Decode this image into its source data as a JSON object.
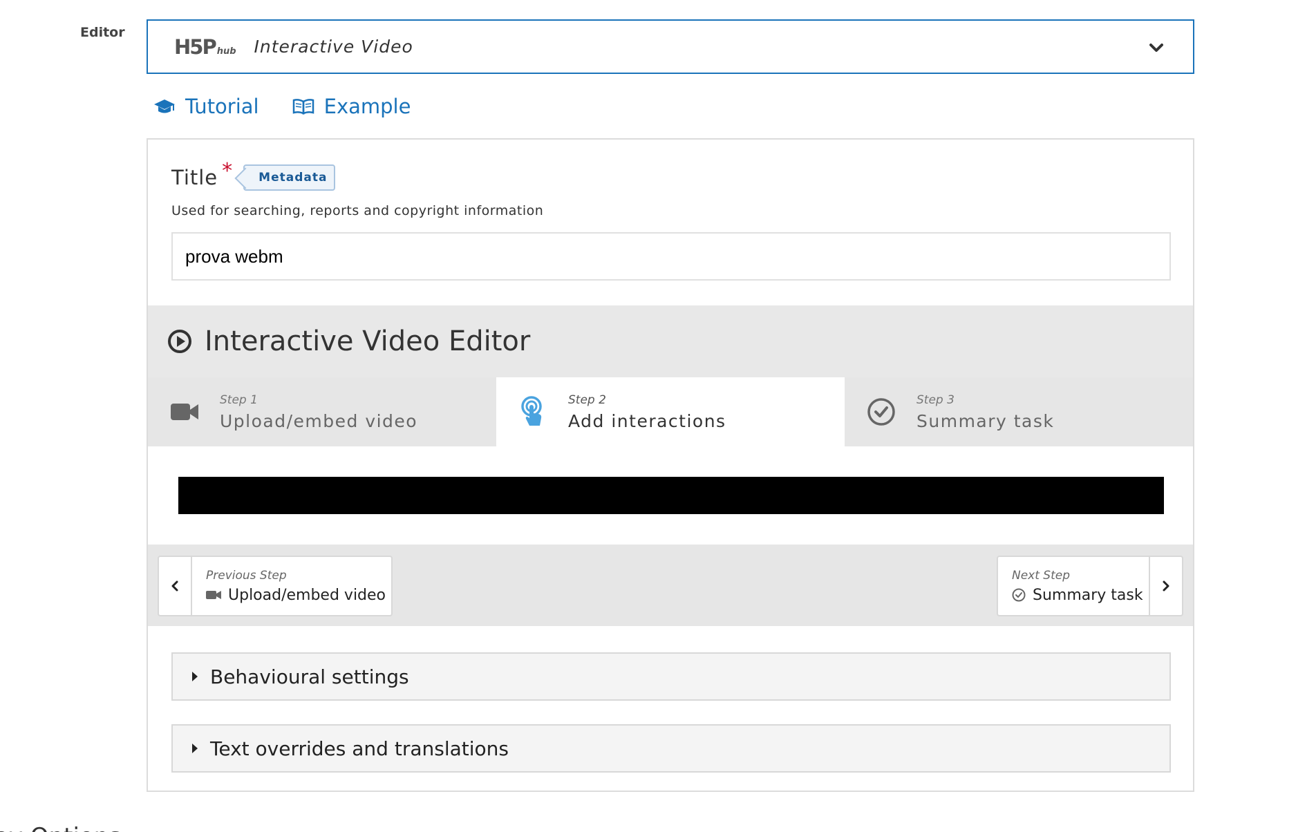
{
  "editor_label": "Editor",
  "hub": {
    "logo_main": "H5P",
    "logo_small": "hub",
    "content_type": "Interactive Video"
  },
  "links": {
    "tutorial": "Tutorial",
    "example": "Example"
  },
  "title_field": {
    "label": "Title",
    "required_mark": "*",
    "metadata_button": "Metadata",
    "description": "Used for searching, reports and copyright information",
    "value": "prova webm"
  },
  "ive": {
    "title": "Interactive Video Editor",
    "steps": [
      {
        "number": "Step 1",
        "name": "Upload/embed video"
      },
      {
        "number": "Step 2",
        "name": "Add interactions"
      },
      {
        "number": "Step 3",
        "name": "Summary task"
      }
    ]
  },
  "navigation": {
    "previous_label": "Previous Step",
    "previous_target": "Upload/embed video",
    "next_label": "Next Step",
    "next_target": "Summary task"
  },
  "sections": {
    "behavioural": "Behavioural settings",
    "text_overrides": "Text overrides and translations"
  },
  "bottom_partial_text": "ay Options",
  "colors": {
    "accent": "#1a73ba",
    "required": "#c8102e",
    "active_step_icon": "#4aa3df"
  }
}
